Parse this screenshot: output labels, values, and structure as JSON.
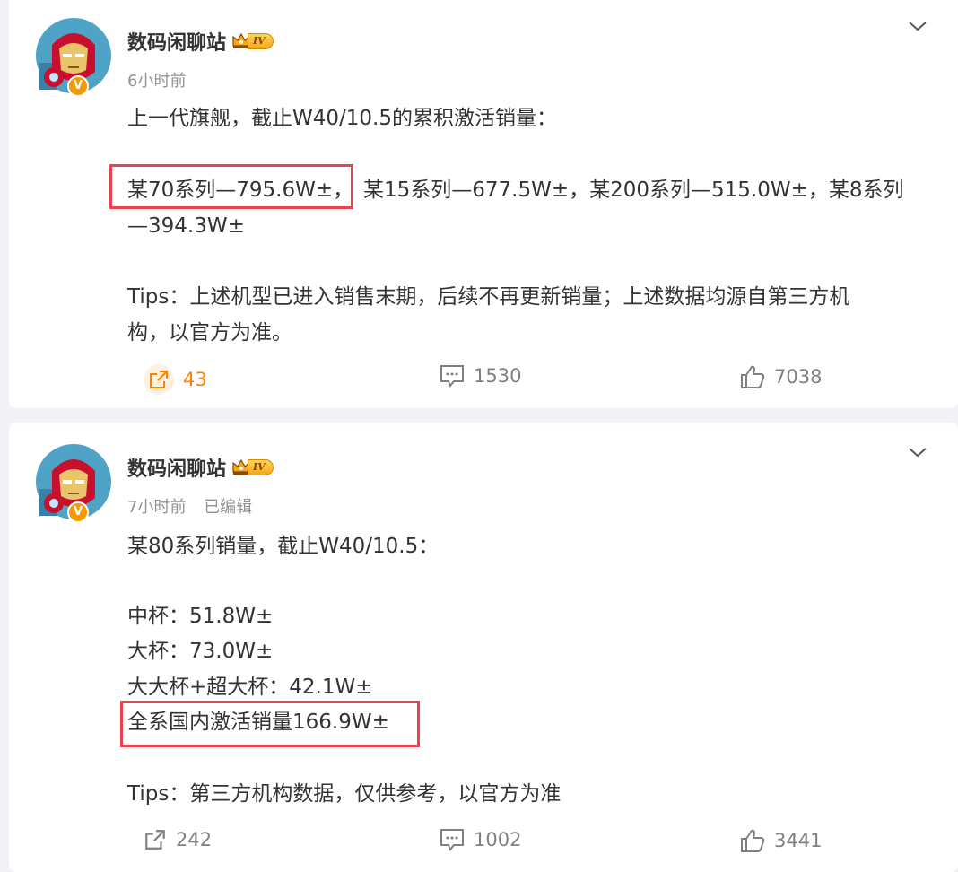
{
  "posts": [
    {
      "user": {
        "name": "数码闲聊站",
        "level": "IV",
        "verified_badge": "V"
      },
      "meta": {
        "time": "6小时前",
        "edited": ""
      },
      "lines": [
        "上一代旗舰，截止W40/10.5的累积激活销量：",
        "某70系列—795.6W±，",
        "某15系列—677.5W±，某200系列—515.0W±，某8系列",
        "—394.3W±",
        "Tips：上述机型已进入销售末期，后续不再更新销量；上述数据均源自第三方机",
        "构，以官方为准。"
      ],
      "actions": {
        "share": "43",
        "comment": "1530",
        "like": "7038"
      }
    },
    {
      "user": {
        "name": "数码闲聊站",
        "level": "IV",
        "verified_badge": "V"
      },
      "meta": {
        "time": "7小时前",
        "edited": "已编辑"
      },
      "lines": [
        "某80系列销量，截止W40/10.5：",
        "中杯：51.8W±",
        "大杯：73.0W±",
        "大大杯+超大杯：42.1W±",
        "全系国内激活销量166.9W±",
        "Tips：第三方机构数据，仅供参考，以官方为准"
      ],
      "actions": {
        "share": "242",
        "comment": "1002",
        "like": "3441"
      }
    }
  ],
  "colors": {
    "accent_orange": "#ff8200",
    "highlight_red": "#e8434f",
    "muted_text": "#939393",
    "body_text": "#333333",
    "page_bg": "#f1f2f5"
  },
  "icons": {
    "avatar": "iron-man-avatar",
    "verified": "verified-v-badge-icon",
    "level": "crown-level-badge-icon",
    "more": "chevron-down-icon",
    "share": "share-icon",
    "comment": "comment-icon",
    "like": "thumbs-up-icon"
  }
}
